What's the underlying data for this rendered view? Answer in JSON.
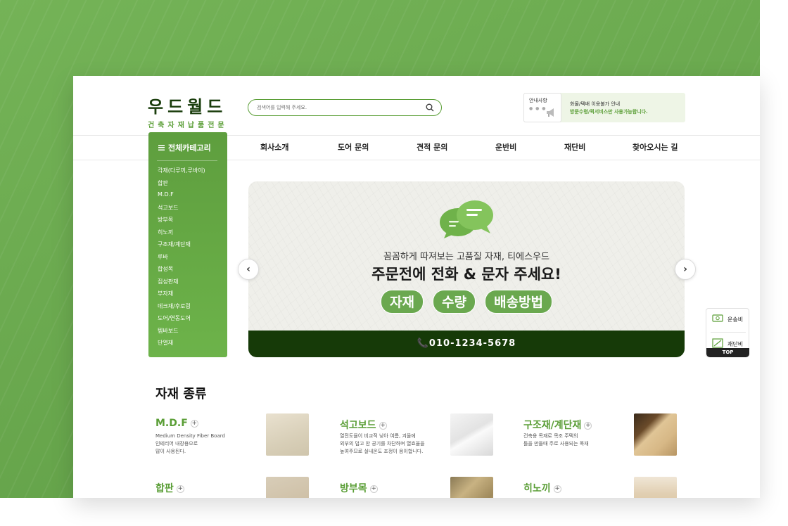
{
  "brand": {
    "name": "우드월드",
    "tagline": "건축자재납품전문"
  },
  "search": {
    "placeholder": "검색어를 입력해 주세요."
  },
  "notice": {
    "box_title": "안내사항",
    "line1": "화물/택배 이용불가 안내",
    "line2": "방문수령/퀵서비스만 사용가능합니다."
  },
  "nav": [
    "회사소개",
    "도어 문의",
    "견적 문의",
    "운반비",
    "재단비",
    "찾아오시는 길"
  ],
  "category": {
    "title": "전체카테고리",
    "items": [
      "각재(다루끼,루바이)",
      "합판",
      "M.D.F",
      "석고보드",
      "방부목",
      "히노끼",
      "구조재/계단재",
      "루바",
      "합성목",
      "집성판재",
      "부자재",
      "데크재/후로링",
      "도어/연동도어",
      "템바보드",
      "단열재"
    ]
  },
  "banner": {
    "sub": "꼼꼼하게 따져보는 고품질 자재, 티에스우드",
    "headline": "주문전에 전화 & 문자 주세요!",
    "pills": [
      "자재",
      "수량",
      "배송방법"
    ],
    "phone": "📞010-1234-5678"
  },
  "quick": {
    "item1": "운송비",
    "item2": "재단비",
    "top": "TOP"
  },
  "materials": {
    "title": "자재 종류",
    "items": [
      {
        "name": "M.D.F",
        "desc": "Medium Density Fiber Board\n인테리어 내장용으로\n많이 사용된다."
      },
      {
        "name": "석고보드",
        "desc": "열전도율이 비교적 낮아 여름, 겨울에\n외부의 덥고 찬 공기를 차단하며 열효율을\n높여주므로 실내온도 조정이 용이합니다."
      },
      {
        "name": "구조재/계단재",
        "desc": "건축용 목재로 목조 주택의\n틀을 만들때 주로 사용되는 목재"
      },
      {
        "name": "합판",
        "desc": ""
      },
      {
        "name": "방부목",
        "desc": ""
      },
      {
        "name": "히노끼",
        "desc": ""
      }
    ]
  },
  "colors": {
    "accent": "#5a9e36",
    "dark": "#163a08",
    "background": "#6aa84f"
  }
}
